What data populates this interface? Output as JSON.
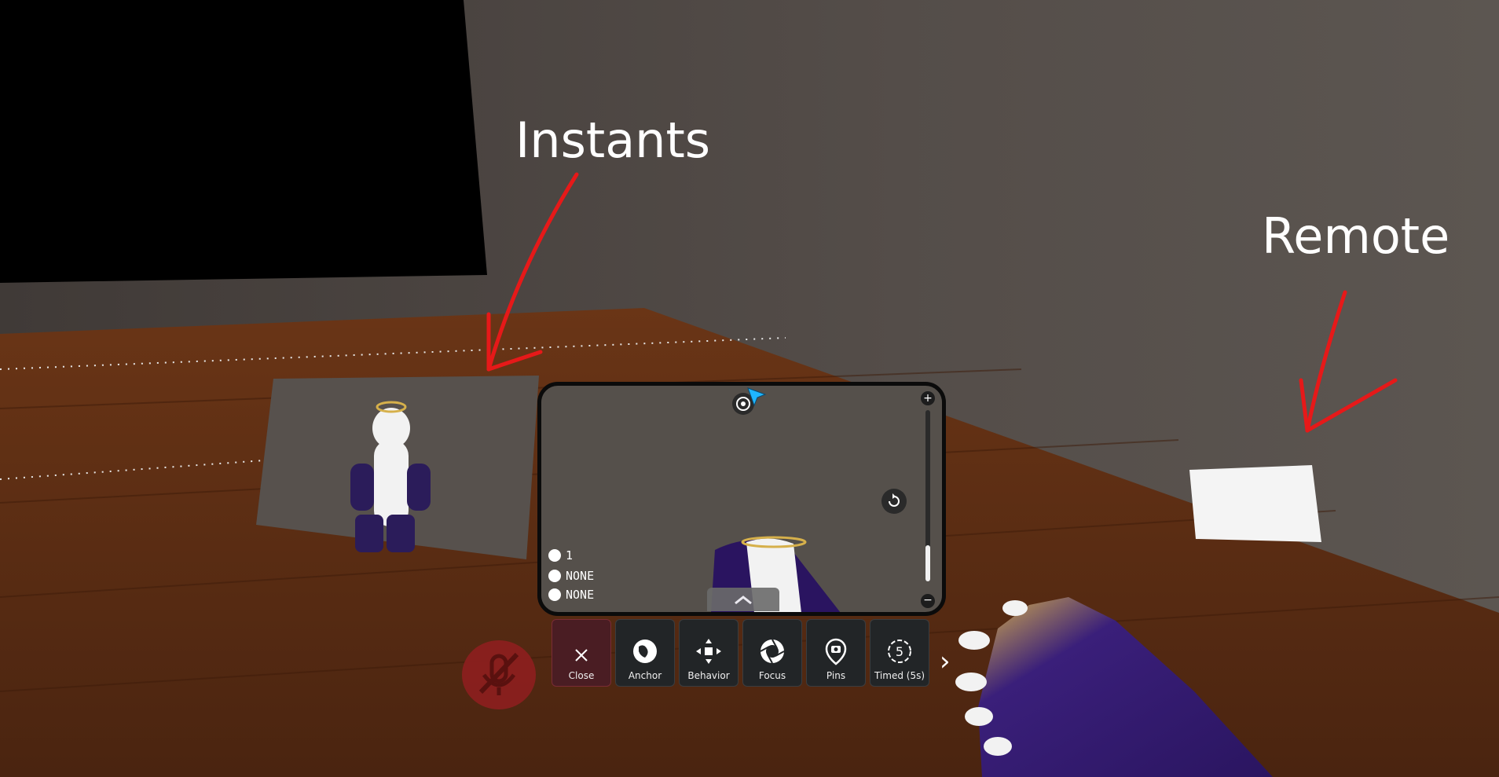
{
  "annotations": {
    "instants": "Instants",
    "remote": "Remote"
  },
  "camera": {
    "status_photos": "1",
    "status_filter": "NONE",
    "status_mode": "NONE",
    "icons": [
      "orbit-icon",
      "cursor-icon",
      "zoom-in-icon",
      "zoom-out-icon",
      "reset-icon",
      "expand-up-icon"
    ]
  },
  "toolbar": {
    "buttons": [
      {
        "label": "Close",
        "icon": "close-icon"
      },
      {
        "label": "Anchor",
        "icon": "globe-icon"
      },
      {
        "label": "Behavior",
        "icon": "move-arrows-icon"
      },
      {
        "label": "Focus",
        "icon": "aperture-icon"
      },
      {
        "label": "Pins",
        "icon": "pin-camera-icon"
      },
      {
        "label": "Timed (5s)",
        "icon": "timer-5-icon"
      }
    ],
    "next_icon": "chevron-right-icon"
  },
  "mic": {
    "icon": "mic-muted-icon"
  },
  "colors": {
    "wall": "#4f4945",
    "floor": "#5a2c12",
    "annotation_arrow": "#e61919",
    "close_button": "#4a1d23",
    "toolbar_button": "#222527",
    "cursor": "#1fb6ff",
    "mic_muted": "#a21f1f"
  }
}
